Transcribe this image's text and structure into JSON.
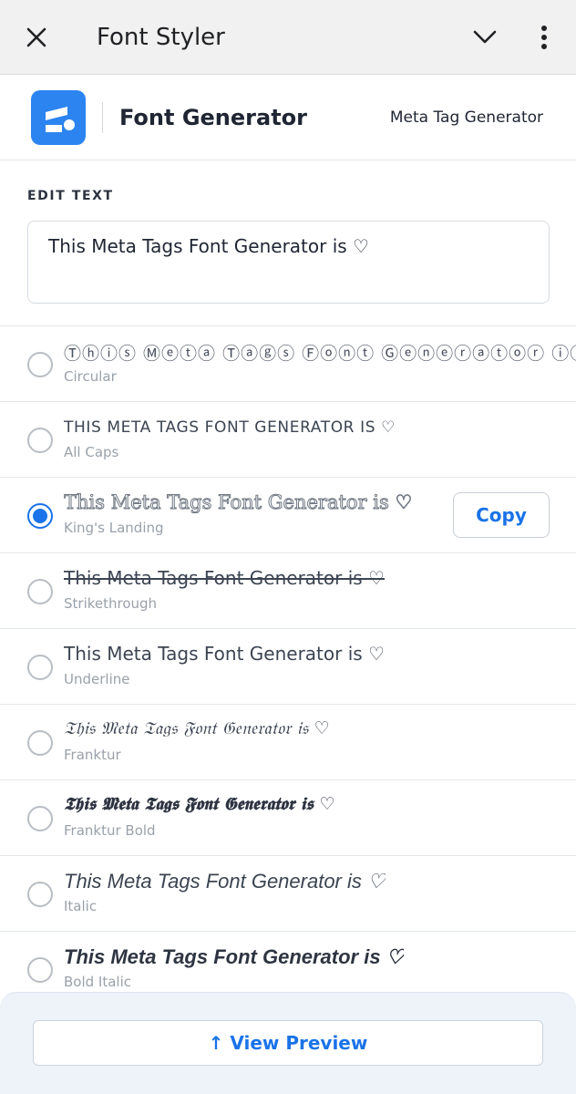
{
  "topbar": {
    "title": "Font Styler",
    "icons": [
      "close-icon",
      "chevron-down-icon",
      "more-vertical-icon"
    ]
  },
  "header": {
    "brand": "Font Generator",
    "nav_link": "Meta Tag Generator",
    "logo_color": "#2b84f0"
  },
  "editor": {
    "label": "EDIT TEXT",
    "value": "This Meta Tags Font Generator is ♡"
  },
  "styles": [
    {
      "name": "Circular",
      "sample": "Ⓣⓗⓘⓢ Ⓜⓔⓣⓐ Ⓣⓐⓖⓢ Ⓕⓞⓝⓣ Ⓖⓔⓝⓔⓡⓐⓣⓞⓡ ⓘⓢ ♡",
      "selected": false
    },
    {
      "name": "All Caps",
      "sample": "THIS META TAGS FONT GENERATOR IS ♡",
      "selected": false
    },
    {
      "name": "King's Landing",
      "sample": "This Meta Tags Font Generator is ♡",
      "selected": true
    },
    {
      "name": "Strikethrough",
      "sample": "This Meta Tags Font Generator is ♡",
      "selected": false
    },
    {
      "name": "Underline",
      "sample": "This Meta Tags Font Generator is ♡",
      "selected": false
    },
    {
      "name": "Franktur",
      "sample": "𝔗𝔥𝔦𝔰 𝔐𝔢𝔱𝔞 𝔗𝔞𝔤𝔰 𝔉𝔬𝔫𝔱 𝔊𝔢𝔫𝔢𝔯𝔞𝔱𝔬𝔯 𝔦𝔰 ♡",
      "selected": false
    },
    {
      "name": "Franktur Bold",
      "sample": "𝕿𝖍𝖎𝖘 𝕸𝖊𝖙𝖆 𝕿𝖆𝖌𝖘 𝕱𝖔𝖓𝖙 𝕲𝖊𝖓𝖊𝖗𝖆𝖙𝖔𝖗 𝖎𝖘 ♡",
      "selected": false
    },
    {
      "name": "Italic",
      "sample": "This Meta Tags Font Generator is ♡",
      "selected": false
    },
    {
      "name": "Bold Italic",
      "sample": "This Meta Tags Font Generator is ♡",
      "selected": false
    }
  ],
  "copy_label": "Copy",
  "preview_label": "↑ View Preview",
  "accent_color": "#1a73e8"
}
